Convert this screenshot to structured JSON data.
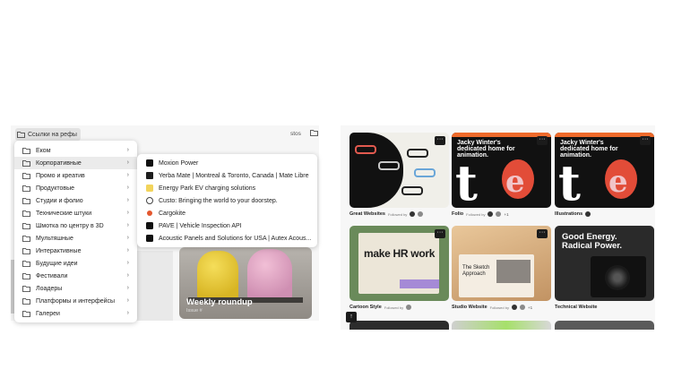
{
  "left_app": {
    "bookmark_folder_label": "Ссылки на рефы",
    "bookmark_right_text": "stos",
    "weekly_card": {
      "title": "Weekly roundup",
      "subtitle": "Issue #"
    },
    "menu_items": [
      {
        "label": "Еком"
      },
      {
        "label": "Корпоративные"
      },
      {
        "label": "Промо и креатив"
      },
      {
        "label": "Продуктовые"
      },
      {
        "label": "Студии и фолио"
      },
      {
        "label": "Технические штуки"
      },
      {
        "label": "Шмотка по центру в 3D"
      },
      {
        "label": "Мультяшные"
      },
      {
        "label": "Интерактивные"
      },
      {
        "label": "Будущие идеи"
      },
      {
        "label": "Фестивали"
      },
      {
        "label": "Лоадеры"
      },
      {
        "label": "Платформы и интерфейсы"
      },
      {
        "label": "Галереи"
      }
    ],
    "submenu_items": [
      {
        "label": "Moxion Power",
        "icon": "moxion-favicon"
      },
      {
        "label": "Yerba Mate | Montreal & Toronto, Canada | Mate Libre",
        "icon": "mate-libre-favicon"
      },
      {
        "label": "Energy Park EV charging solutions",
        "icon": "energy-park-favicon"
      },
      {
        "label": "Custo: Bringing the world to your doorstep.",
        "icon": "custo-favicon"
      },
      {
        "label": "Cargokite",
        "icon": "cargokite-favicon"
      },
      {
        "label": "PAVE | Vehicle Inspection API",
        "icon": "pave-favicon"
      },
      {
        "label": "Acoustic Panels and Solutions for USA | Autex Acous...",
        "icon": "autex-favicon"
      }
    ]
  },
  "right_app": {
    "cards": [
      {
        "label": "Great Websites",
        "by": "Followed by",
        "plus": ""
      },
      {
        "label": "Folio",
        "by": "Followed by",
        "plus": "+1"
      },
      {
        "label": "Illustrations",
        "by": "Followed by",
        "plus": ""
      },
      {
        "label": "Cartoon Style",
        "by": "Followed by",
        "plus": ""
      },
      {
        "label": "Studio Website",
        "by": "Followed by",
        "plus": "+1"
      },
      {
        "label": "Technical Website",
        "by": "",
        "plus": ""
      }
    ],
    "folio_heading": "Jacky Winter's dedicated home for animation.",
    "illus_heading": "Jacky Winter's dedicated home for animation.",
    "cartoon_text": "make HR work",
    "studio_text": "The Sketch Approach",
    "tech_text": "Good Energy. Radical Power.",
    "card_menu_glyph": "···",
    "corner_glyph": "↑"
  }
}
